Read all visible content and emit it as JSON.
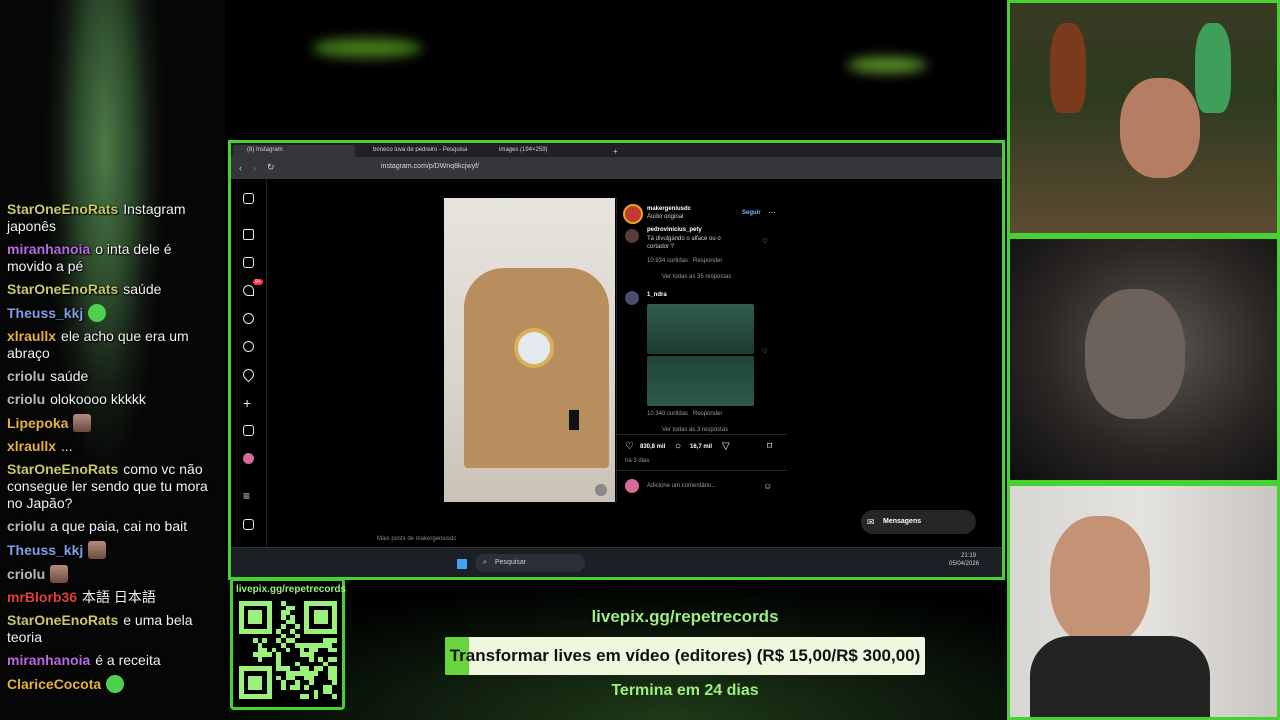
{
  "chat": {
    "messages": [
      {
        "user": "StarOneEnoRats",
        "color": "#c9c96a",
        "text": "Instagram japonês"
      },
      {
        "user": "miranhanoia",
        "color": "#b76be0",
        "text": "o inta dele é movido a pé"
      },
      {
        "user": "StarOneEnoRats",
        "color": "#c9c96a",
        "text": "saúde"
      },
      {
        "user": "Theuss_kkj",
        "color": "#7f9fe8",
        "text": "",
        "emote": "green"
      },
      {
        "user": "xlraullx",
        "color": "#e8b23a",
        "text": "ele acho que era um abraço"
      },
      {
        "user": "criolu",
        "color": "#b9b9b9",
        "text": "saúde"
      },
      {
        "user": "criolu",
        "color": "#b9b9b9",
        "text": "olokoooo kkkkk"
      },
      {
        "user": "Lipepoka",
        "color": "#e8b23a",
        "text": "",
        "emote": "face"
      },
      {
        "user": "xlraullx",
        "color": "#e8b23a",
        "text": "..."
      },
      {
        "user": "StarOneEnoRats",
        "color": "#c9c96a",
        "text": "como vc não consegue ler sendo que tu mora no Japão?"
      },
      {
        "user": "criolu",
        "color": "#b9b9b9",
        "text": "a que paia, cai no bait"
      },
      {
        "user": "Theuss_kkj",
        "color": "#7f9fe8",
        "text": "",
        "emote": "face"
      },
      {
        "user": "criolu",
        "color": "#b9b9b9",
        "text": "",
        "emote": "face"
      },
      {
        "user": "mrBlorb36",
        "color": "#e0403a",
        "text": "本語 日本語"
      },
      {
        "user": "StarOneEnoRats",
        "color": "#c9c96a",
        "text": "e uma bela teoria"
      },
      {
        "user": "miranhanoia",
        "color": "#b76be0",
        "text": "é a receita"
      },
      {
        "user": "ClariceCocota",
        "color": "#e8b23a",
        "text": "",
        "emote": "green"
      }
    ]
  },
  "browser": {
    "tabs": [
      "(8) Instagram",
      "boneco luva de pedreiro - Pesquisa",
      "images (194×259)",
      "+"
    ],
    "url": "instagram.com/p/DWnq8kcjwyf/"
  },
  "instagram": {
    "author": "makergeniusdc",
    "audio": "Áudio original",
    "follow": "Seguir",
    "comment1_user": "pedrovinicius_pety",
    "comment1_text": "Tá divulgando o alface ou o cortador ?",
    "comment1_meta": "10.934 curtidas",
    "comment1_reply": "Responder",
    "comment1_replies": "Ver todas as 35 respostas",
    "comment2_user": "1_ndra",
    "comment2_meta": "10.340 curtidas",
    "comment2_reply": "Responder",
    "comment2_replies": "Ver todas as 3 respostas",
    "likes": "830,8 mil",
    "comments": "16,7 mil",
    "time_ago": "há 3 dias",
    "add_comment": "Adicione um comentário...",
    "more_posts": "Mais posts de makergeniusdc",
    "messages_label": "Mensagens",
    "notif_badge": "9+"
  },
  "taskbar": {
    "search": "Pesquisar",
    "time": "21:19",
    "date": "05/04/2026"
  },
  "donation": {
    "qr_label": "livepix.gg/repetrecords",
    "url": "livepix.gg/repetrecords",
    "goal_text": "Transformar lives em vídeo (editores) (R$ 15,00/R$ 300,00)",
    "goal_progress": 0.05,
    "ends": "Termina em 24 dias"
  },
  "colors": {
    "accent": "#46d233",
    "donation_text": "#9cf07c"
  }
}
